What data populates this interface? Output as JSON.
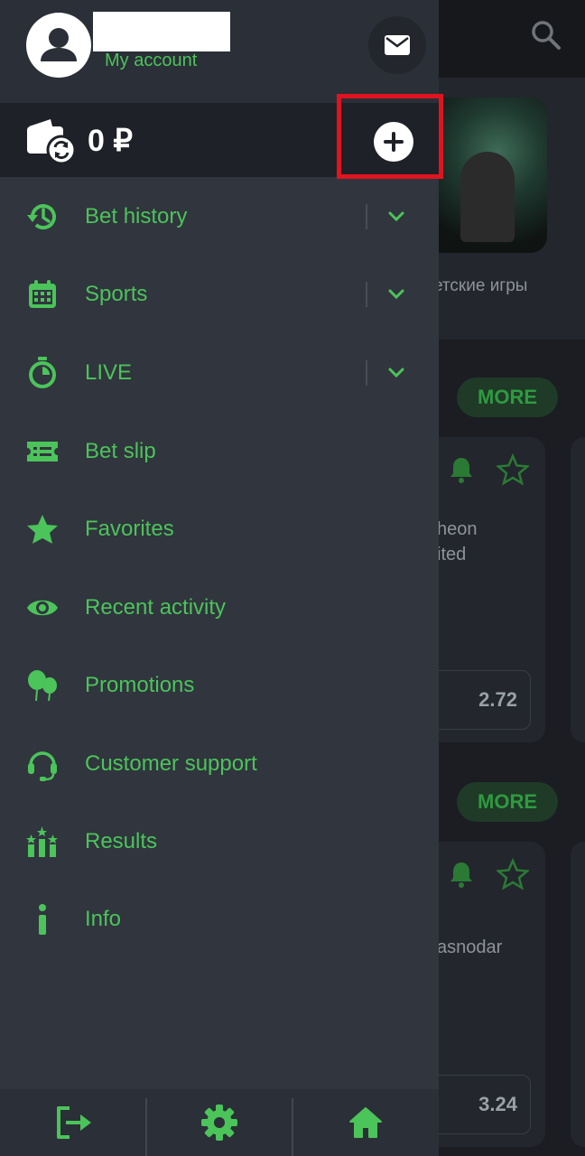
{
  "colors": {
    "accent": "#4bc45a",
    "highlight": "#e0141f",
    "drawer_bg": "#31353e"
  },
  "header": {
    "account_label": "My account",
    "icons": {
      "avatar": "user-avatar-icon",
      "mail": "mail-icon"
    }
  },
  "balance": {
    "amount": "0 ₽",
    "icons": {
      "wallet": "wallet-refresh-icon",
      "add": "plus-circle-icon"
    }
  },
  "menu": {
    "items": [
      {
        "label": "Bet history",
        "icon": "history-icon",
        "expandable": true
      },
      {
        "label": "Sports",
        "icon": "calendar-icon",
        "expandable": true
      },
      {
        "label": "LIVE",
        "icon": "stopwatch-icon",
        "expandable": true
      },
      {
        "label": "Bet slip",
        "icon": "ticket-icon",
        "expandable": false
      },
      {
        "label": "Favorites",
        "icon": "star-icon",
        "expandable": false
      },
      {
        "label": "Recent activity",
        "icon": "eye-icon",
        "expandable": false
      },
      {
        "label": "Promotions",
        "icon": "balloons-icon",
        "expandable": false
      },
      {
        "label": "Customer support",
        "icon": "headset-icon",
        "expandable": false
      },
      {
        "label": "Results",
        "icon": "results-icon",
        "expandable": false
      },
      {
        "label": "Info",
        "icon": "info-icon",
        "expandable": false
      }
    ]
  },
  "bottom_bar": {
    "icons": [
      "logout-icon",
      "settings-icon",
      "home-icon"
    ]
  },
  "background": {
    "game_label": "етские игры",
    "more_label_1": "MORE",
    "more_label_2": "MORE",
    "card1": {
      "team_line1": "heon",
      "team_line2": "ited",
      "odd": "2.72"
    },
    "card2": {
      "team_line1": "asnodar",
      "odd": "3.24"
    }
  }
}
